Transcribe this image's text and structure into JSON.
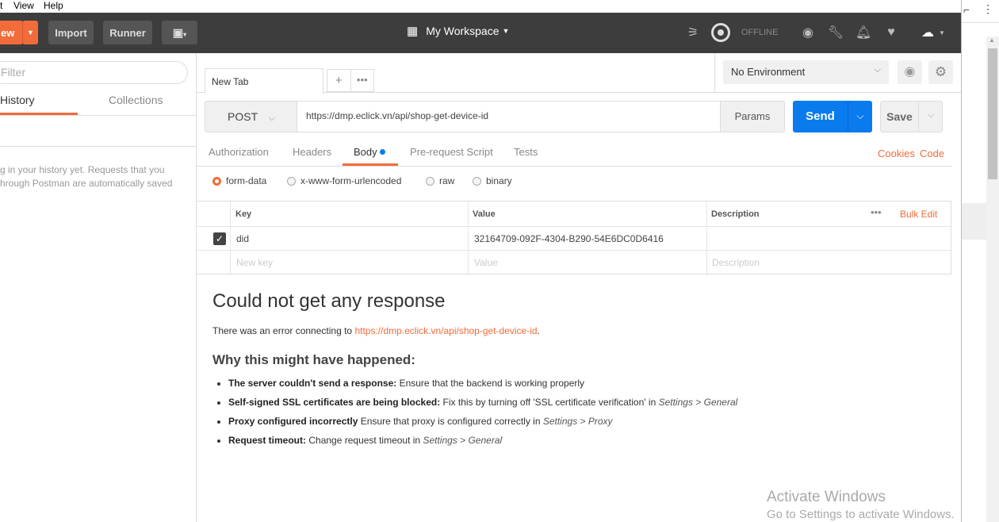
{
  "menu": [
    "t",
    "View",
    "Help"
  ],
  "toolbar": {
    "new_label": "ew",
    "import_label": "Import",
    "runner_label": "Runner",
    "workspace_label": "My Workspace",
    "offline_label": "OFFLINE"
  },
  "sidebar": {
    "filter_placeholder": "Filter",
    "tabs": [
      "History",
      "Collections"
    ],
    "empty_line1": "g in your history yet. Requests that you",
    "empty_line2": "hrough Postman are automatically saved"
  },
  "env": {
    "selected": "No Environment"
  },
  "tabs": {
    "active": "New Tab"
  },
  "request": {
    "method": "POST",
    "url": "https://dmp.eclick.vn/api/shop-get-device-id",
    "params_label": "Params",
    "send_label": "Send",
    "save_label": "Save"
  },
  "subtabs": [
    "Authorization",
    "Headers",
    "Body",
    "Pre-request Script",
    "Tests"
  ],
  "links": {
    "cookies": "Cookies",
    "code": "Code"
  },
  "body_modes": [
    "form-data",
    "x-www-form-urlencoded",
    "raw",
    "binary"
  ],
  "kv_table": {
    "headers": {
      "key": "Key",
      "value": "Value",
      "description": "Description",
      "bulk": "Bulk Edit"
    },
    "rows": [
      {
        "key": "did",
        "value": "32164709-092F-4304-B290-54E6DC0D6416",
        "description": ""
      }
    ],
    "placeholders": {
      "key": "New key",
      "value": "Value",
      "description": "Description"
    }
  },
  "response": {
    "title": "Could not get any response",
    "error_prefix": "There was an error connecting to ",
    "error_url": "https://dmp.eclick.vn/api/shop-get-device-id",
    "error_suffix": ".",
    "why_title": "Why this might have happened:",
    "reasons": [
      {
        "bold": "The server couldn't send a response:",
        "text": " Ensure that the backend is working properly",
        "ital": ""
      },
      {
        "bold": "Self-signed SSL certificates are being blocked:",
        "text": " Fix this by turning off 'SSL certificate verification' in ",
        "ital": "Settings > General"
      },
      {
        "bold": "Proxy configured incorrectly",
        "text": " Ensure that proxy is configured correctly in ",
        "ital": "Settings > Proxy"
      },
      {
        "bold": "Request timeout:",
        "text": " Change request timeout in ",
        "ital": "Settings > General"
      }
    ]
  },
  "watermark": {
    "line1": "Activate Windows",
    "line2": "Go to Settings to activate Windows."
  },
  "colors": {
    "accent": "#f26b3a",
    "send": "#097bed",
    "toolbar": "#3d3d3d"
  }
}
